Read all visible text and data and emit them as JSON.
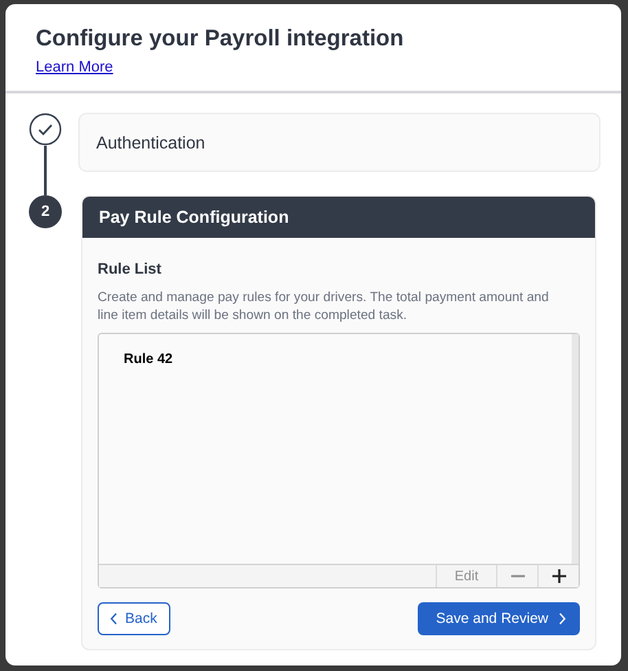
{
  "modal": {
    "title": "Configure your Payroll integration",
    "link": "Learn More"
  },
  "steps": [
    {
      "kind": "done",
      "label": "Authentication"
    },
    {
      "kind": "current",
      "number": "2",
      "label": "Pay Rule Configuration"
    }
  ],
  "rule_list": {
    "heading": "Rule List",
    "description": "Create and manage pay rules for your drivers. The total payment amount and line item details will be shown on the completed task.",
    "rules": [
      {
        "name": "Rule 42"
      }
    ],
    "toolbar": [
      {
        "kind": "text",
        "label": "Edit",
        "disabled": true
      },
      {
        "kind": "minus",
        "disabled": true
      },
      {
        "kind": "plus",
        "disabled": false
      }
    ]
  },
  "buttons": {
    "back": "Back",
    "save": "Save and Review"
  }
}
